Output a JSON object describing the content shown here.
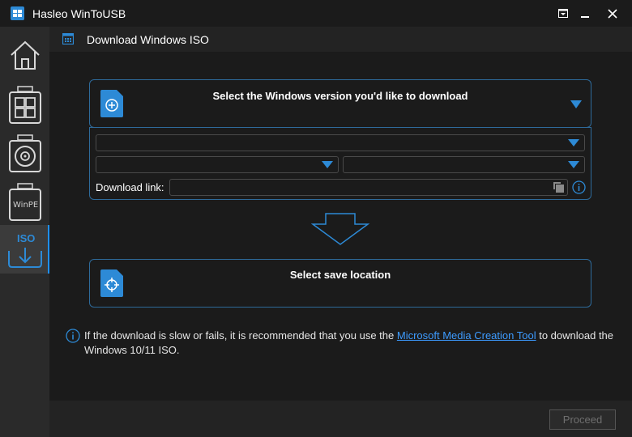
{
  "window": {
    "title": "Hasleo WinToUSB",
    "controls": [
      "menu-icon",
      "minimize-icon",
      "close-icon"
    ]
  },
  "sidebar": {
    "items": [
      {
        "name": "home",
        "icon": "home-icon"
      },
      {
        "name": "windows-to-usb",
        "icon": "windows-usb-icon"
      },
      {
        "name": "disc-to-usb",
        "icon": "disc-usb-icon"
      },
      {
        "name": "winpe",
        "icon": "winpe-usb-icon",
        "label": "WinPE"
      },
      {
        "name": "iso-download",
        "icon": "iso-download-icon",
        "label": "ISO",
        "active": true
      }
    ]
  },
  "header": {
    "title": "Download Windows ISO"
  },
  "version_panel": {
    "heading": "Select the Windows version you'd like to download",
    "download_link_label": "Download link:",
    "download_link_value": ""
  },
  "save_panel": {
    "heading": "Select save location"
  },
  "info": {
    "text_before": "If the download is slow or fails, it is recommended that you use the ",
    "link_text": "Microsoft Media Creation Tool",
    "text_after": " to download the Windows 10/11 ISO."
  },
  "footer": {
    "proceed_label": "Proceed"
  },
  "colors": {
    "accent": "#2d8ad6",
    "panel_border": "#2e6a9a",
    "background": "#1b1b1b",
    "link": "#3d9bff"
  }
}
